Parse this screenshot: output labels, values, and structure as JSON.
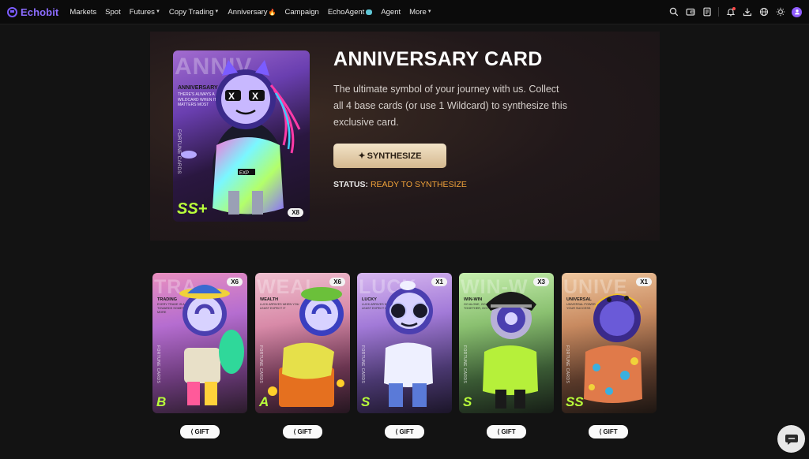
{
  "nav": {
    "brand": "Echobit",
    "items": [
      {
        "label": "Markets",
        "caret": false
      },
      {
        "label": "Spot",
        "caret": false
      },
      {
        "label": "Futures",
        "caret": true
      },
      {
        "label": "Copy Trading",
        "caret": true
      },
      {
        "label": "Anniversary",
        "caret": false,
        "emoji": "fire-icon"
      },
      {
        "label": "Campaign",
        "caret": false
      },
      {
        "label": "EchoAgent",
        "caret": false,
        "emoji": "ai-badge-icon"
      },
      {
        "label": "Agent",
        "caret": false
      },
      {
        "label": "More",
        "caret": true
      }
    ],
    "icons": [
      "search-icon",
      "wallet-icon",
      "orders-icon",
      "bell-icon",
      "download-icon",
      "globe-icon",
      "theme-icon",
      "avatar"
    ]
  },
  "hero": {
    "title": "ANNIVERSARY CARD",
    "description": "The ultimate symbol of your journey with us. Collect all 4 base cards (or use 1 Wildcard) to synthesize this exclusive card.",
    "button_label": "SYNTHESIZE",
    "status_label": "STATUS:",
    "status_value": "READY TO SYNTHESIZE",
    "card": {
      "word": "ANNIV",
      "caption": "ANNIVERSARY",
      "subtext": "THERE'S ALWAYS A WILDCARD WHEN IT MATTERS MOST",
      "side": "FORTUNE CARDS",
      "grade": "SS+",
      "count": "X8"
    }
  },
  "cards": [
    {
      "word": "TRA",
      "caption": "TRADING",
      "subtext": "EVERY TRADE IS A STEP TOWARDS SOMETHING MORE",
      "side": "FORTUNE CARDS",
      "grade": "B",
      "count": "X6",
      "gift": "GIFT"
    },
    {
      "word": "WEAL",
      "caption": "WEALTH",
      "subtext": "LUCK ARRIVES WHEN YOU LEAST EXPECT IT",
      "side": "FORTUNE CARDS",
      "grade": "A",
      "count": "X6",
      "gift": "GIFT"
    },
    {
      "word": "LUCK",
      "caption": "LUCKY",
      "subtext": "LUCK ARRIVES WHEN YOU LEAST EXPECT IT",
      "side": "FORTUNE CARDS",
      "grade": "S",
      "count": "X1",
      "gift": "GIFT"
    },
    {
      "word": "WIN-W",
      "caption": "WIN-WIN",
      "subtext": "GO ALONE, GO FAST. GO TOGETHER, GO FURTHER",
      "side": "FORTUNE CARDS",
      "grade": "S",
      "count": "X3",
      "gift": "GIFT"
    },
    {
      "word": "UNIVE",
      "caption": "UNIVERSAL",
      "subtext": "UNIVERSAL POWER, FUEL YOUR SUCCESS",
      "side": "FORTUNE CARDS",
      "grade": "SS",
      "count": "X1",
      "gift": "GIFT"
    }
  ],
  "colors": {
    "brand": "#8c6cff",
    "status_accent": "#f0a23a",
    "grade": "#b9ff3a",
    "button_gold": "#d5b98f"
  }
}
